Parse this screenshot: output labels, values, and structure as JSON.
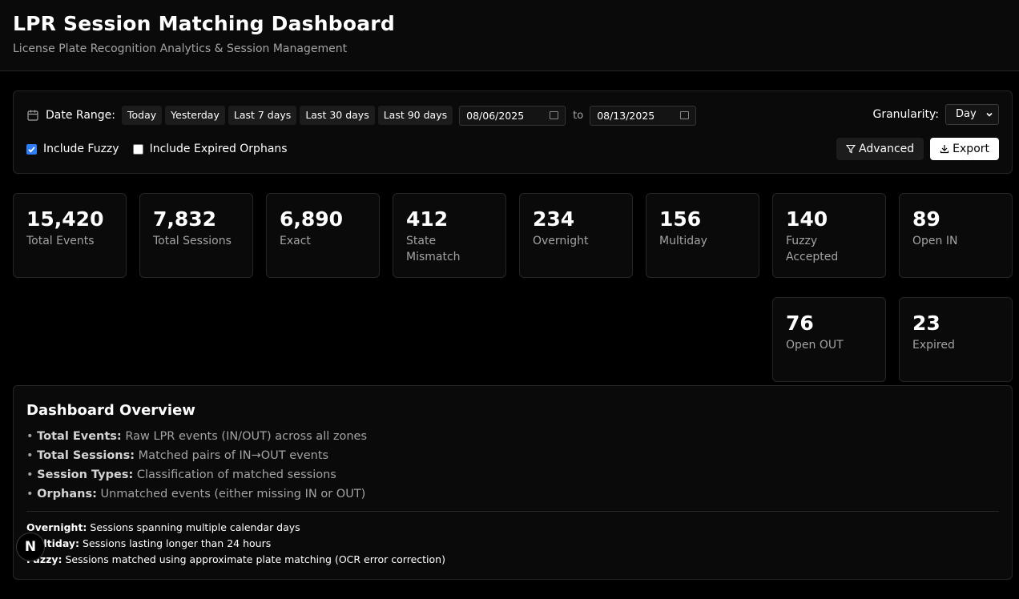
{
  "header": {
    "title": "LPR Session Matching Dashboard",
    "subtitle": "License Plate Recognition Analytics & Session Management"
  },
  "filters": {
    "calendar_icon": "calendar-icon",
    "date_range_label": "Date Range:",
    "presets": [
      "Today",
      "Yesterday",
      "Last 7 days",
      "Last 30 days",
      "Last 90 days"
    ],
    "start_date": "08/06/2025",
    "to_label": "to",
    "end_date": "08/13/2025",
    "granularity_label": "Granularity:",
    "granularity_value": "Day",
    "include_fuzzy": {
      "label": "Include Fuzzy",
      "checked": true
    },
    "include_expired_orphans": {
      "label": "Include Expired Orphans",
      "checked": false
    },
    "advanced_label": "Advanced",
    "advanced_icon": "filter-icon",
    "export_label": "Export",
    "export_icon": "download-icon"
  },
  "stats": [
    {
      "value": "15,420",
      "label": "Total Events"
    },
    {
      "value": "7,832",
      "label": "Total Sessions"
    },
    {
      "value": "6,890",
      "label": "Exact"
    },
    {
      "value": "412",
      "label": "State Mismatch"
    },
    {
      "value": "234",
      "label": "Overnight"
    },
    {
      "value": "156",
      "label": "Multiday"
    },
    {
      "value": "140",
      "label": "Fuzzy Accepted"
    },
    {
      "value": "89",
      "label": "Open IN"
    },
    {
      "value": "76",
      "label": "Open OUT"
    },
    {
      "value": "23",
      "label": "Expired"
    }
  ],
  "overview": {
    "title": "Dashboard Overview",
    "items": [
      {
        "term": "Total Events:",
        "desc": "Raw LPR events (IN/OUT) across all zones"
      },
      {
        "term": "Total Sessions:",
        "desc": "Matched pairs of IN→OUT events"
      },
      {
        "term": "Session Types:",
        "desc": "Classification of matched sessions"
      },
      {
        "term": "Orphans:",
        "desc": "Unmatched events (either missing IN or OUT)"
      }
    ],
    "notes": [
      {
        "term": "Overnight:",
        "desc": "Sessions spanning multiple calendar days"
      },
      {
        "term": "Multiday:",
        "desc": "Sessions lasting longer than 24 hours"
      },
      {
        "term": "Fuzzy:",
        "desc": "Sessions matched using approximate plate matching (OCR error correction)"
      }
    ]
  },
  "dev_badge": "N",
  "colors": {
    "accent_checkbox": "#2f7df6",
    "background": "#000000",
    "card": "#0a0a0a",
    "border": "#262626"
  }
}
